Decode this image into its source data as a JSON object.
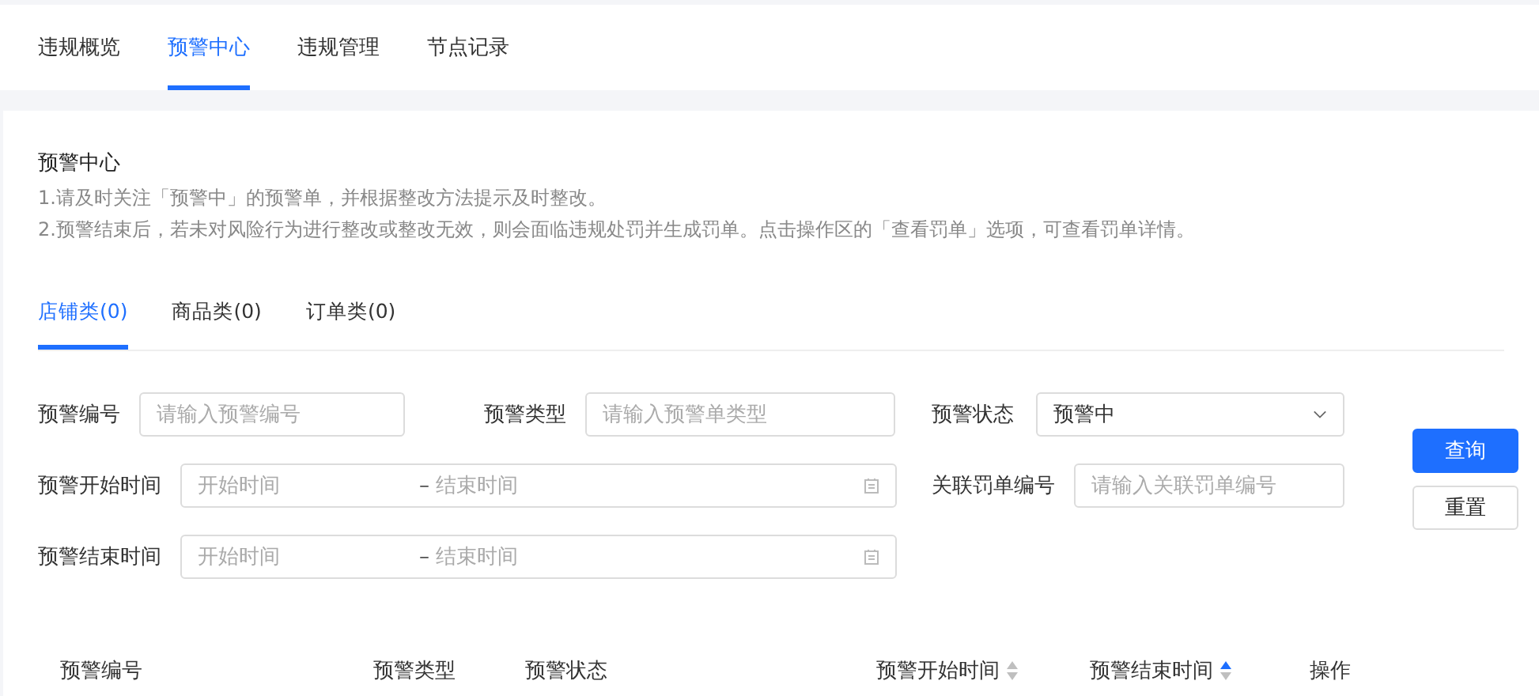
{
  "top_tabs": [
    {
      "label": "违规概览",
      "selected": false
    },
    {
      "label": "预警中心",
      "selected": true
    },
    {
      "label": "违规管理",
      "selected": false
    },
    {
      "label": "节点记录",
      "selected": false
    }
  ],
  "section": {
    "title": "预警中心",
    "notes": [
      "1.请及时关注「预警中」的预警单，并根据整改方法提示及时整改。",
      "2.预警结束后，若未对风险行为进行整改或整改无效，则会面临违规处罚并生成罚单。点击操作区的「查看罚单」选项，可查看罚单详情。"
    ]
  },
  "category_tabs": [
    {
      "label": "店铺类(0)",
      "selected": true
    },
    {
      "label": "商品类(0)",
      "selected": false
    },
    {
      "label": "订单类(0)",
      "selected": false
    }
  ],
  "filters": [
    {
      "kind": "input",
      "label": "预警编号",
      "placeholder": "请输入预警编号"
    },
    {
      "kind": "input",
      "label": "预警类型",
      "placeholder": "请输入预警单类型"
    },
    {
      "kind": "select",
      "label": "预警状态",
      "value": "预警中"
    },
    {
      "kind": "range",
      "label": "预警开始时间",
      "start_placeholder": "开始时间",
      "separator": "–",
      "end_placeholder": "结束时间"
    },
    {
      "kind": "input",
      "label": "关联罚单编号",
      "placeholder": "请输入关联罚单编号"
    },
    {
      "kind": "range",
      "label": "预警结束时间",
      "start_placeholder": "开始时间",
      "separator": "–",
      "end_placeholder": "结束时间"
    }
  ],
  "buttons": [
    {
      "label": "查询",
      "kind": "primary"
    },
    {
      "label": "重置",
      "kind": "default"
    }
  ],
  "table": {
    "columns": [
      {
        "label": "预警编号"
      },
      {
        "label": "预警类型"
      },
      {
        "label": "预警状态"
      },
      {
        "label": "预警开始时间",
        "sort_ascending": false,
        "sort_descending": false
      },
      {
        "label": "预警结束时间",
        "sort_ascending": true,
        "sort_descending": false
      },
      {
        "label": "操作"
      }
    ]
  }
}
